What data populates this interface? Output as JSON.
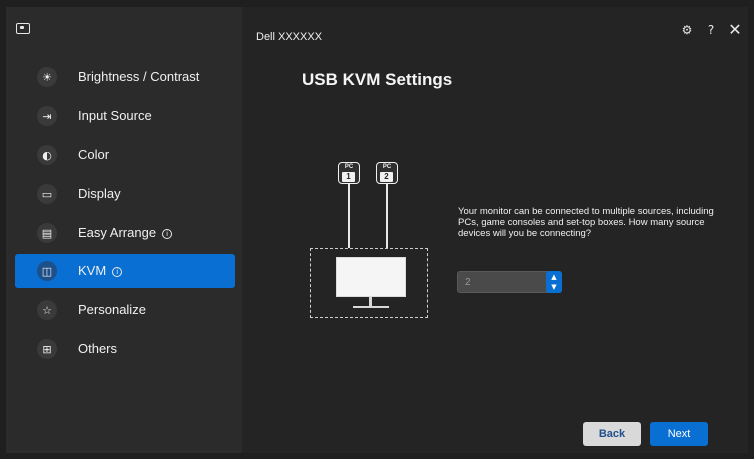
{
  "window": {
    "monitor_name": "Dell XXXXXX"
  },
  "sidebar": {
    "items": [
      {
        "label": "Brightness / Contrast",
        "icon": "sun-icon",
        "active": false
      },
      {
        "label": "Input Source",
        "icon": "input-source-icon",
        "active": false
      },
      {
        "label": "Color",
        "icon": "palette-icon",
        "active": false
      },
      {
        "label": "Display",
        "icon": "monitor-icon",
        "active": false
      },
      {
        "label": "Easy Arrange",
        "icon": "layout-icon",
        "active": false,
        "info": true
      },
      {
        "label": "KVM",
        "icon": "kvm-icon",
        "active": true,
        "info": true
      },
      {
        "label": "Personalize",
        "icon": "star-icon",
        "active": false
      },
      {
        "label": "Others",
        "icon": "settings-box-icon",
        "active": false
      }
    ]
  },
  "header": {
    "icons": [
      "settings-icon",
      "help-icon",
      "close-icon"
    ]
  },
  "main": {
    "title": "USB KVM Settings",
    "diagram": {
      "pc_label": "PC",
      "pcs": [
        "1",
        "2"
      ]
    },
    "description": "Your monitor can be connected to multiple sources, including PCs, game consoles and set-top boxes. How many source devices will you be connecting?",
    "source_count": "2"
  },
  "footer": {
    "back_label": "Back",
    "next_label": "Next"
  },
  "colors": {
    "accent": "#0a6fd2",
    "sidebar_bg": "#2b2b2b",
    "main_bg": "#242424"
  }
}
